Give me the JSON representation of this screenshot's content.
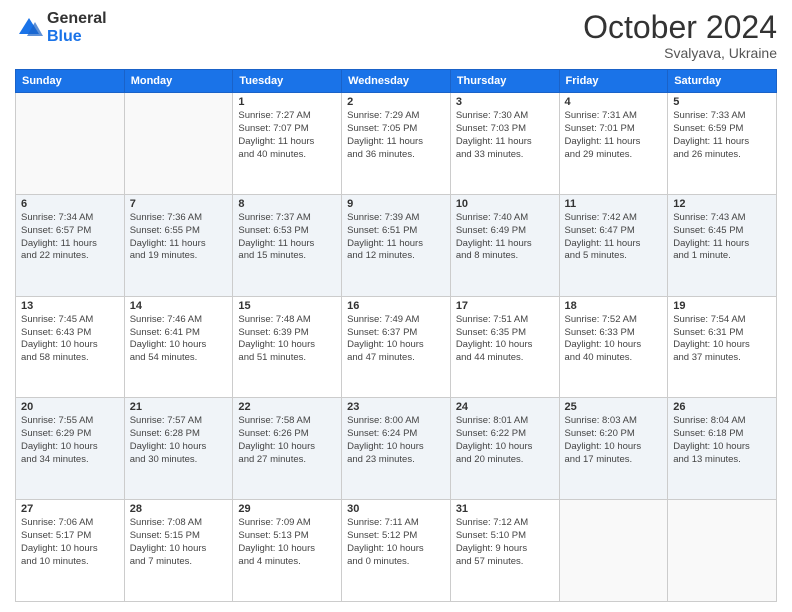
{
  "header": {
    "logo_general": "General",
    "logo_blue": "Blue",
    "month": "October 2024",
    "location": "Svalyava, Ukraine"
  },
  "weekdays": [
    "Sunday",
    "Monday",
    "Tuesday",
    "Wednesday",
    "Thursday",
    "Friday",
    "Saturday"
  ],
  "weeks": [
    [
      {
        "day": "",
        "info": ""
      },
      {
        "day": "",
        "info": ""
      },
      {
        "day": "1",
        "info": "Sunrise: 7:27 AM\nSunset: 7:07 PM\nDaylight: 11 hours\nand 40 minutes."
      },
      {
        "day": "2",
        "info": "Sunrise: 7:29 AM\nSunset: 7:05 PM\nDaylight: 11 hours\nand 36 minutes."
      },
      {
        "day": "3",
        "info": "Sunrise: 7:30 AM\nSunset: 7:03 PM\nDaylight: 11 hours\nand 33 minutes."
      },
      {
        "day": "4",
        "info": "Sunrise: 7:31 AM\nSunset: 7:01 PM\nDaylight: 11 hours\nand 29 minutes."
      },
      {
        "day": "5",
        "info": "Sunrise: 7:33 AM\nSunset: 6:59 PM\nDaylight: 11 hours\nand 26 minutes."
      }
    ],
    [
      {
        "day": "6",
        "info": "Sunrise: 7:34 AM\nSunset: 6:57 PM\nDaylight: 11 hours\nand 22 minutes."
      },
      {
        "day": "7",
        "info": "Sunrise: 7:36 AM\nSunset: 6:55 PM\nDaylight: 11 hours\nand 19 minutes."
      },
      {
        "day": "8",
        "info": "Sunrise: 7:37 AM\nSunset: 6:53 PM\nDaylight: 11 hours\nand 15 minutes."
      },
      {
        "day": "9",
        "info": "Sunrise: 7:39 AM\nSunset: 6:51 PM\nDaylight: 11 hours\nand 12 minutes."
      },
      {
        "day": "10",
        "info": "Sunrise: 7:40 AM\nSunset: 6:49 PM\nDaylight: 11 hours\nand 8 minutes."
      },
      {
        "day": "11",
        "info": "Sunrise: 7:42 AM\nSunset: 6:47 PM\nDaylight: 11 hours\nand 5 minutes."
      },
      {
        "day": "12",
        "info": "Sunrise: 7:43 AM\nSunset: 6:45 PM\nDaylight: 11 hours\nand 1 minute."
      }
    ],
    [
      {
        "day": "13",
        "info": "Sunrise: 7:45 AM\nSunset: 6:43 PM\nDaylight: 10 hours\nand 58 minutes."
      },
      {
        "day": "14",
        "info": "Sunrise: 7:46 AM\nSunset: 6:41 PM\nDaylight: 10 hours\nand 54 minutes."
      },
      {
        "day": "15",
        "info": "Sunrise: 7:48 AM\nSunset: 6:39 PM\nDaylight: 10 hours\nand 51 minutes."
      },
      {
        "day": "16",
        "info": "Sunrise: 7:49 AM\nSunset: 6:37 PM\nDaylight: 10 hours\nand 47 minutes."
      },
      {
        "day": "17",
        "info": "Sunrise: 7:51 AM\nSunset: 6:35 PM\nDaylight: 10 hours\nand 44 minutes."
      },
      {
        "day": "18",
        "info": "Sunrise: 7:52 AM\nSunset: 6:33 PM\nDaylight: 10 hours\nand 40 minutes."
      },
      {
        "day": "19",
        "info": "Sunrise: 7:54 AM\nSunset: 6:31 PM\nDaylight: 10 hours\nand 37 minutes."
      }
    ],
    [
      {
        "day": "20",
        "info": "Sunrise: 7:55 AM\nSunset: 6:29 PM\nDaylight: 10 hours\nand 34 minutes."
      },
      {
        "day": "21",
        "info": "Sunrise: 7:57 AM\nSunset: 6:28 PM\nDaylight: 10 hours\nand 30 minutes."
      },
      {
        "day": "22",
        "info": "Sunrise: 7:58 AM\nSunset: 6:26 PM\nDaylight: 10 hours\nand 27 minutes."
      },
      {
        "day": "23",
        "info": "Sunrise: 8:00 AM\nSunset: 6:24 PM\nDaylight: 10 hours\nand 23 minutes."
      },
      {
        "day": "24",
        "info": "Sunrise: 8:01 AM\nSunset: 6:22 PM\nDaylight: 10 hours\nand 20 minutes."
      },
      {
        "day": "25",
        "info": "Sunrise: 8:03 AM\nSunset: 6:20 PM\nDaylight: 10 hours\nand 17 minutes."
      },
      {
        "day": "26",
        "info": "Sunrise: 8:04 AM\nSunset: 6:18 PM\nDaylight: 10 hours\nand 13 minutes."
      }
    ],
    [
      {
        "day": "27",
        "info": "Sunrise: 7:06 AM\nSunset: 5:17 PM\nDaylight: 10 hours\nand 10 minutes."
      },
      {
        "day": "28",
        "info": "Sunrise: 7:08 AM\nSunset: 5:15 PM\nDaylight: 10 hours\nand 7 minutes."
      },
      {
        "day": "29",
        "info": "Sunrise: 7:09 AM\nSunset: 5:13 PM\nDaylight: 10 hours\nand 4 minutes."
      },
      {
        "day": "30",
        "info": "Sunrise: 7:11 AM\nSunset: 5:12 PM\nDaylight: 10 hours\nand 0 minutes."
      },
      {
        "day": "31",
        "info": "Sunrise: 7:12 AM\nSunset: 5:10 PM\nDaylight: 9 hours\nand 57 minutes."
      },
      {
        "day": "",
        "info": ""
      },
      {
        "day": "",
        "info": ""
      }
    ]
  ]
}
